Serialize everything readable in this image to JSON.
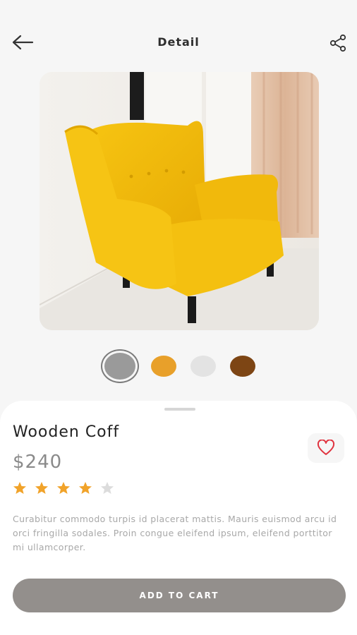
{
  "header": {
    "title": "Detail",
    "back_icon": "arrow-left-icon",
    "share_icon": "share-icon"
  },
  "product": {
    "image": "yellow-wingback-armchair",
    "name": "Wooden Coff",
    "price": "$240",
    "rating": 4,
    "rating_max": 5,
    "description": "Curabitur commodo turpis id placerat mattis. Mauris euismod arcu id orci fringilla sodales. Proin congue eleifend ipsum, eleifend porttitor mi ullamcorper.",
    "favorite_icon": "heart-icon"
  },
  "colors": {
    "options": [
      "#9a9a9a",
      "#e8a02a",
      "#e3e3e3",
      "#7d4514"
    ],
    "selected_index": 0,
    "star_filled": "#f1a32a",
    "star_empty": "#dcdcdc",
    "heart": "#e0333f",
    "button": "#938f8c"
  },
  "actions": {
    "add_to_cart": "ADD TO CART"
  }
}
